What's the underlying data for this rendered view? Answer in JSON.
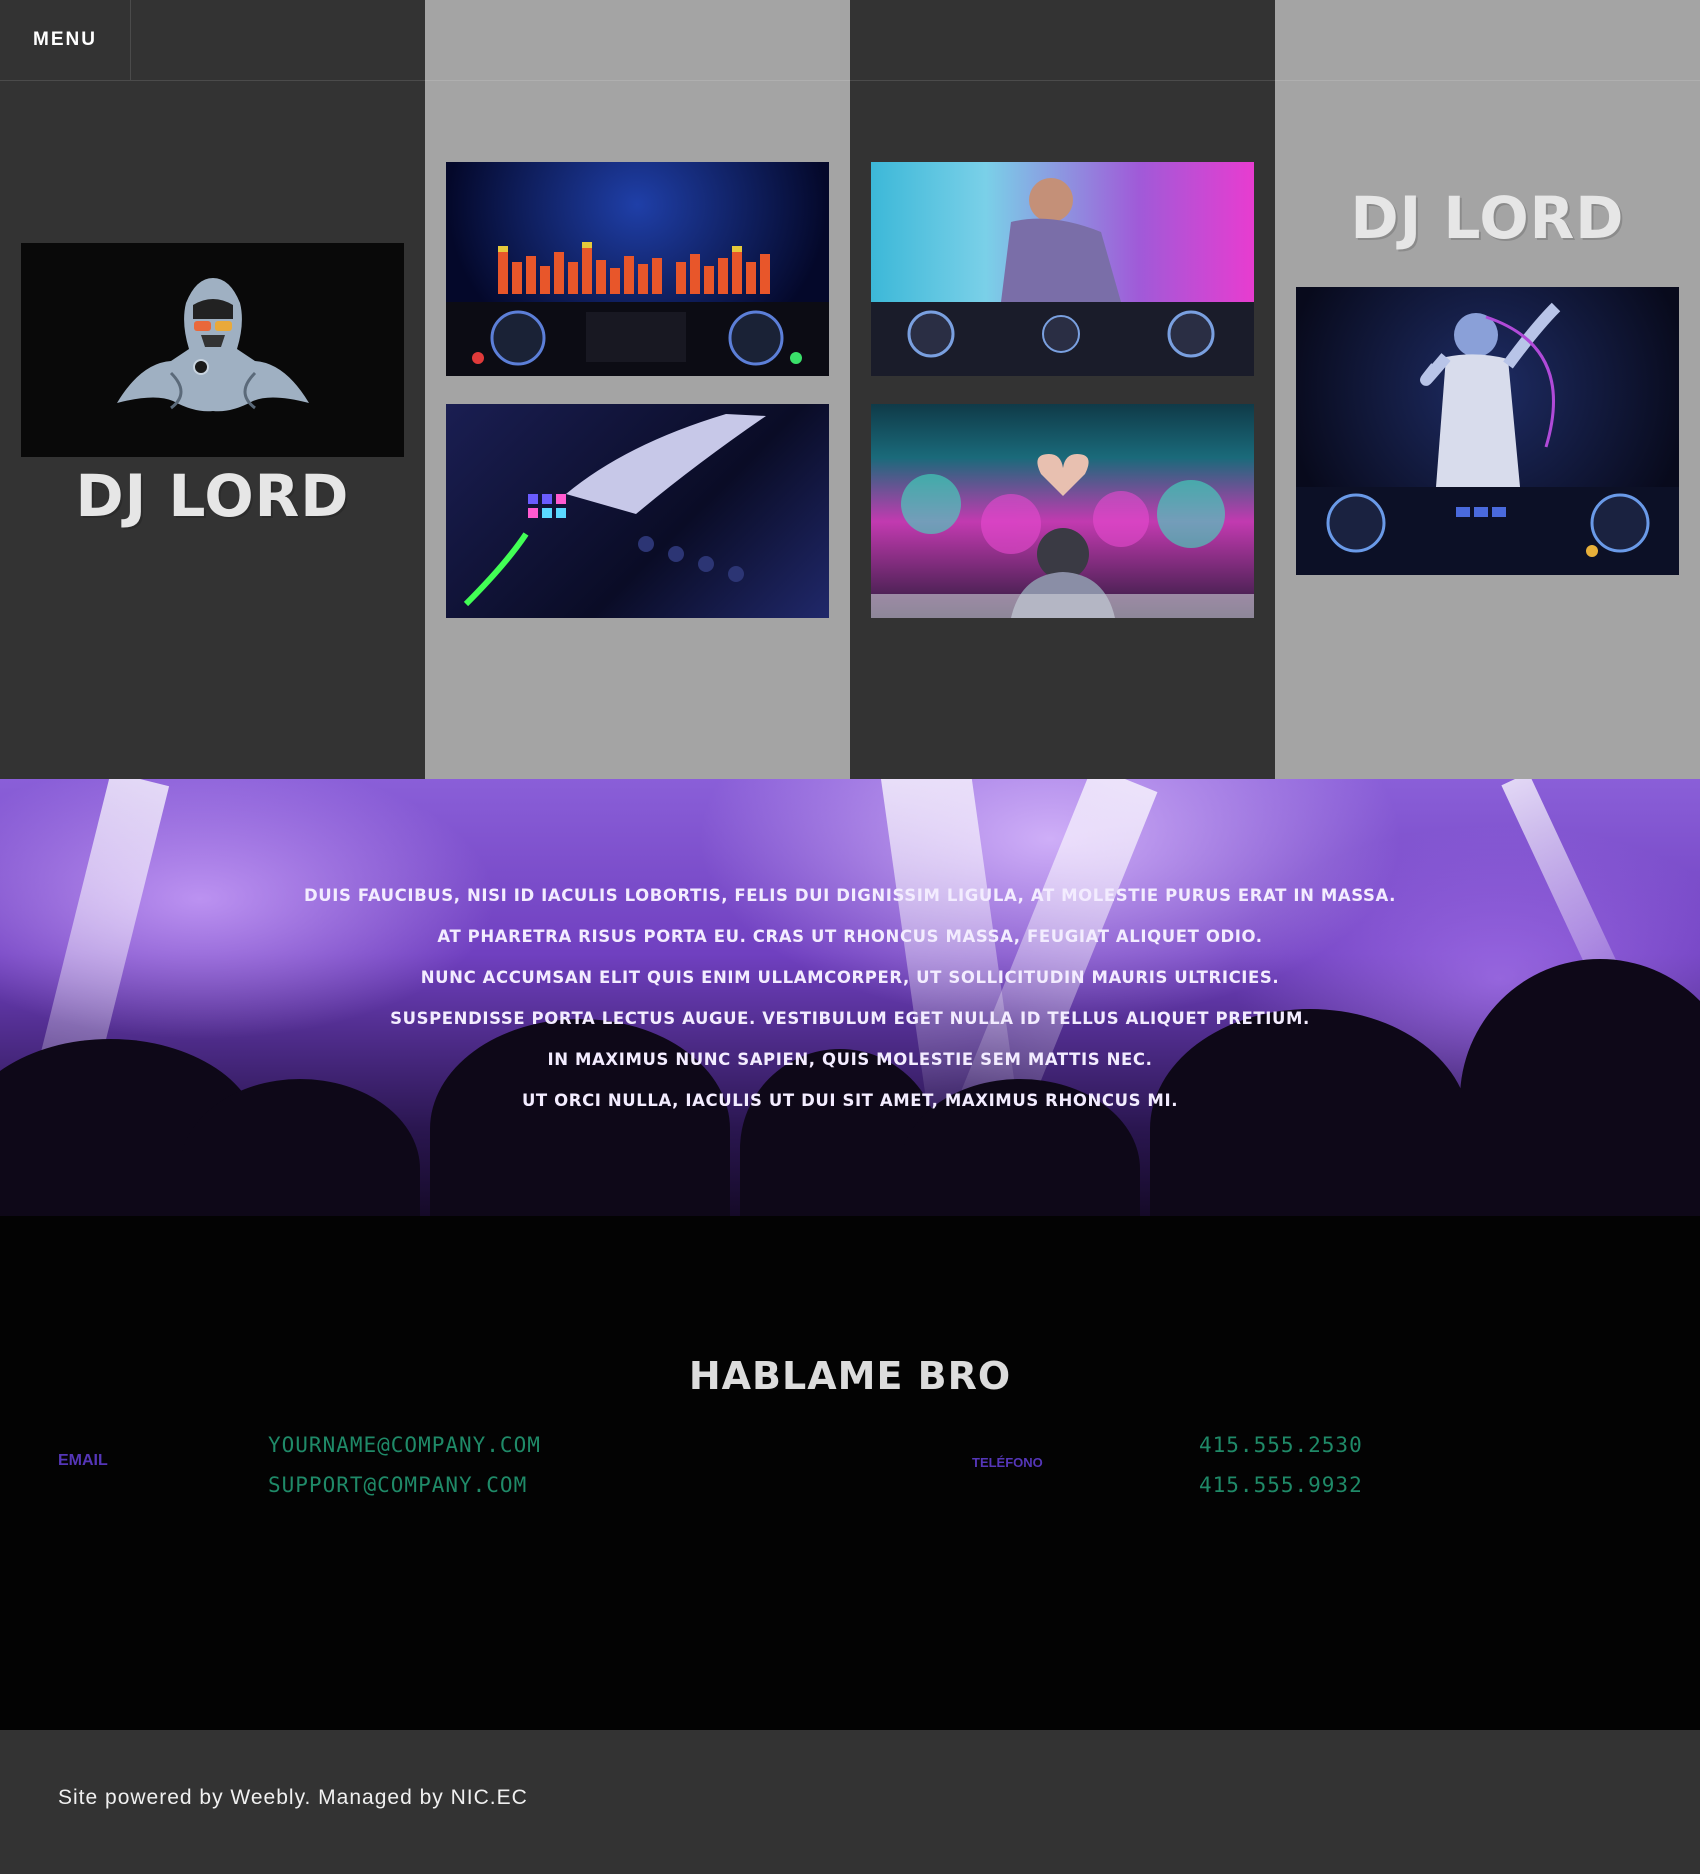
{
  "nav": {
    "menu_label": "MENU"
  },
  "brand": {
    "logo_text": "DJ LORD"
  },
  "gallery": {
    "images": [
      {
        "name": "darth-vader-dj-logo"
      },
      {
        "name": "equalizer-dj-decks"
      },
      {
        "name": "dj-mixing-in-smoke"
      },
      {
        "name": "hand-on-mixer"
      },
      {
        "name": "dj-heart-hands-crowd"
      },
      {
        "name": "dj-dancing-decks"
      }
    ]
  },
  "banner": {
    "lines": [
      "Duis faucibus, nisi id iaculis lobortis, felis dui dignissim ligula, at molestie purus erat in massa.",
      "At pharetra risus porta eu. Cras ut rhoncus massa, feugiat aliquet odio.",
      "Nunc accumsan elit quis enim ullamcorper, ut sollicitudin mauris ultricies.",
      "Suspendisse porta lectus augue. Vestibulum eget nulla id tellus aliquet pretium.",
      "In maximus nunc sapien, quis molestie sem mattis nec.",
      "Ut orci nulla, iaculis ut dui sit amet, maximus rhoncus mi."
    ]
  },
  "contact": {
    "title": "HABLAME BRO",
    "email_label": "EMAIL",
    "emails": [
      "YOURNAME@COMPANY.COM",
      "SUPPORT@COMPANY.COM"
    ],
    "phone_label": "TELÉFONO",
    "phones": [
      "415.555.2530",
      "415.555.9932"
    ]
  },
  "footer": {
    "text": "Site powered by Weebly. Managed by NIC.EC"
  },
  "colors": {
    "dark_panel": "#333333",
    "light_panel": "#a4a4a4",
    "label_purple": "#5536b8",
    "value_green": "#1f8a68"
  }
}
